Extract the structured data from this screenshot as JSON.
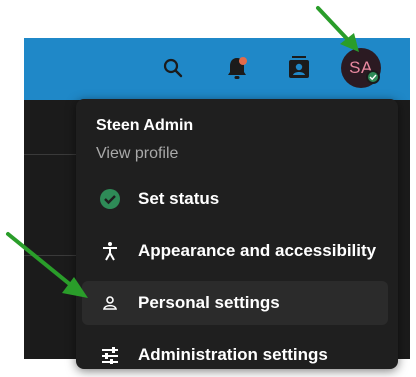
{
  "header": {
    "search_icon": "search-icon",
    "notifications_icon": "bell-icon",
    "contacts_icon": "contacts-icon",
    "avatar_initials": "SA",
    "accent_color": "#1f88c8",
    "notification_dot_color": "#e06b4b",
    "status_color": "#2e8b57"
  },
  "menu": {
    "user_name": "Steen Admin",
    "view_profile": "View profile",
    "items": [
      {
        "label": "Set status",
        "icon": "check-circle-icon"
      },
      {
        "label": "Appearance and accessibility",
        "icon": "accessibility-icon"
      },
      {
        "label": "Personal settings",
        "icon": "person-icon"
      },
      {
        "label": "Administration settings",
        "icon": "sliders-icon"
      }
    ]
  },
  "annotation_color": "#2a9d2a"
}
